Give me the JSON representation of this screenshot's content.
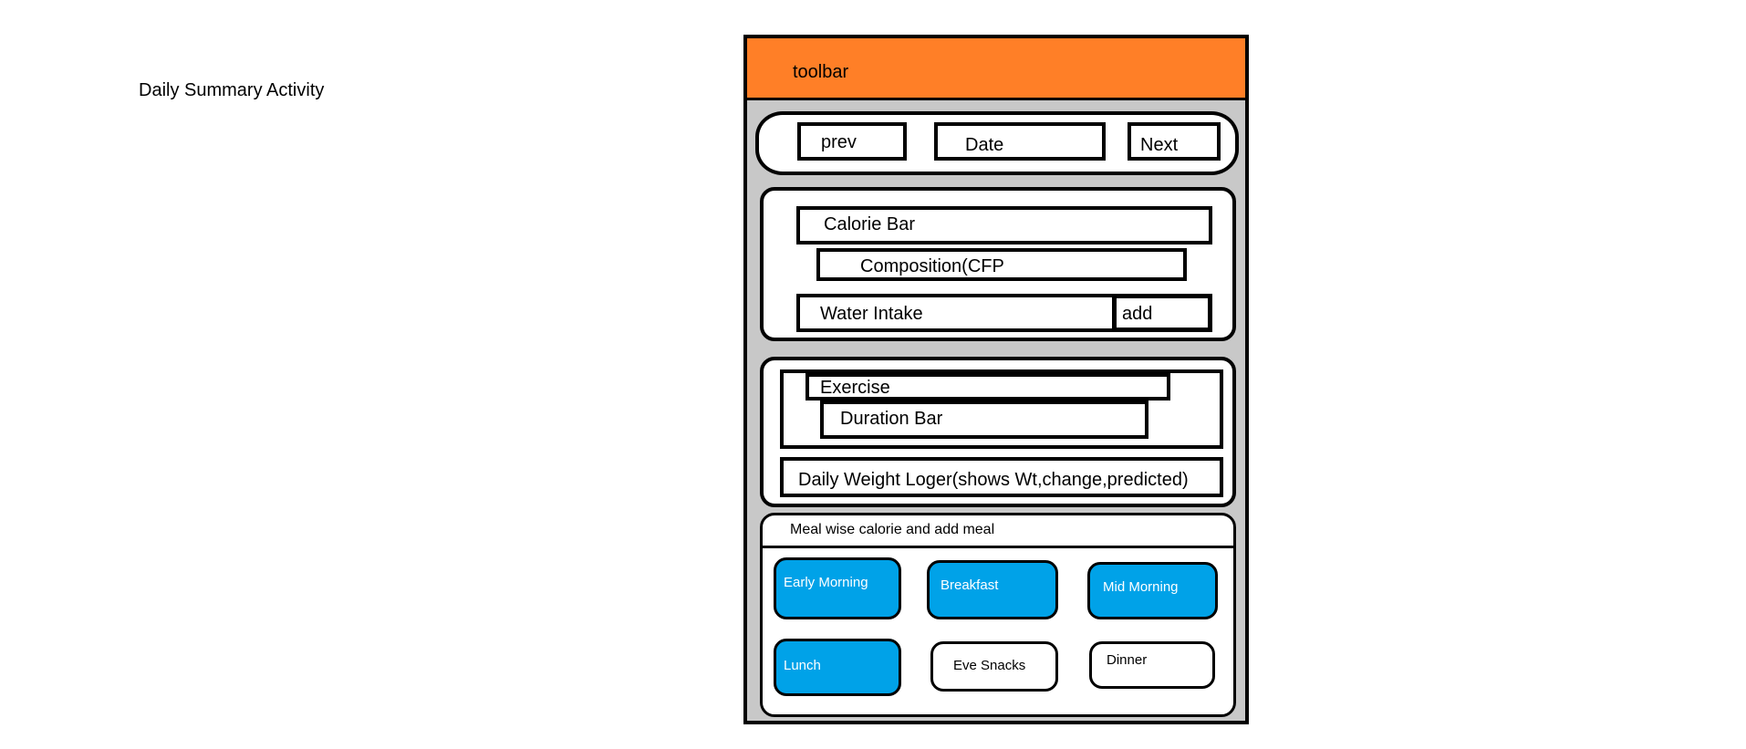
{
  "page": {
    "label": "Daily Summary Activity"
  },
  "toolbar": {
    "title": "toolbar",
    "color": "#ff7f27"
  },
  "date_nav": {
    "prev_label": "prev",
    "date_label": "Date",
    "next_label": "Next"
  },
  "nutrition": {
    "calorie_bar": "Calorie Bar",
    "composition": "Composition(CFP",
    "water_intake": "Water Intake",
    "add_label": "add"
  },
  "activity": {
    "exercise": "Exercise",
    "duration_bar": "Duration Bar",
    "weight_logger": "Daily Weight Loger(shows Wt,change,predicted)"
  },
  "meals": {
    "header": "Meal wise calorie and add meal",
    "items": [
      {
        "label": "Early Morning",
        "style": "filled"
      },
      {
        "label": "Breakfast",
        "style": "filled"
      },
      {
        "label": "Mid Morning",
        "style": "filled"
      },
      {
        "label": "Lunch",
        "style": "filled"
      },
      {
        "label": "Eve Snacks",
        "style": "plain"
      },
      {
        "label": "Dinner",
        "style": "plain"
      }
    ],
    "filled_color": "#00a2e8"
  }
}
